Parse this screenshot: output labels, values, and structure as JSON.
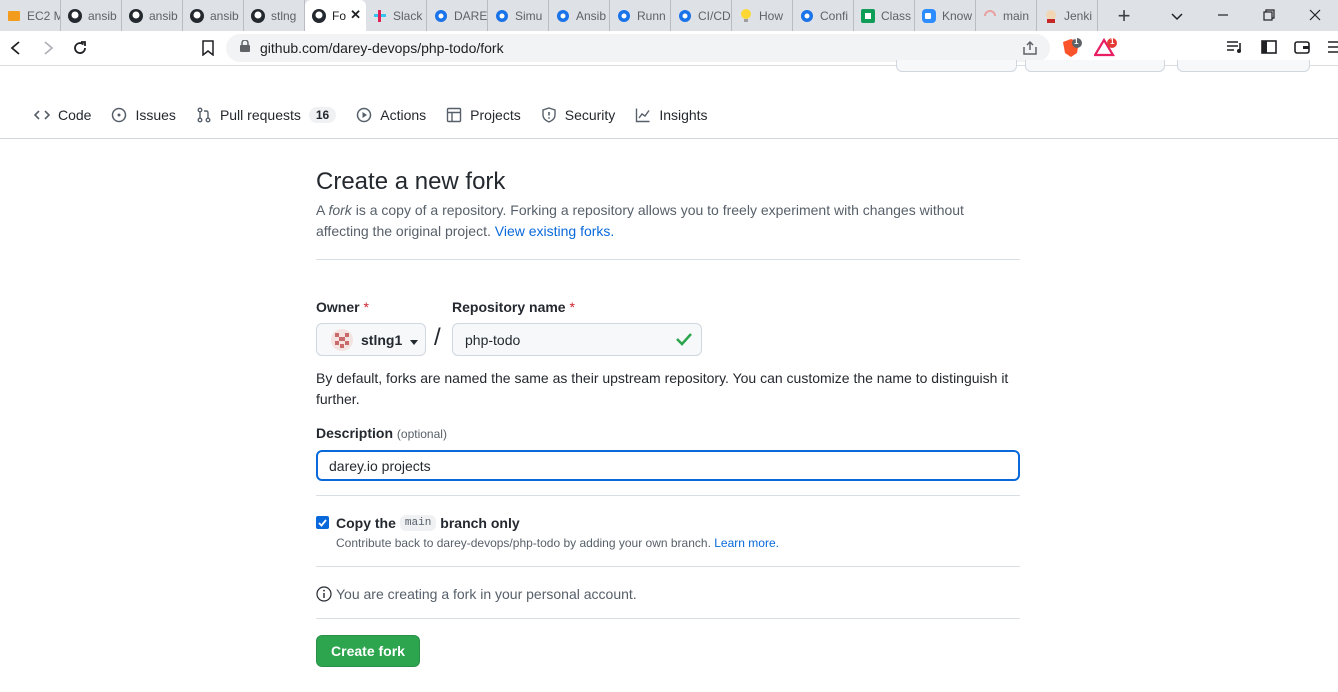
{
  "browser": {
    "tabs": [
      {
        "label": "EC2 M",
        "icon": "aws-icon"
      },
      {
        "label": "ansib",
        "icon": "github-icon"
      },
      {
        "label": "ansib",
        "icon": "github-icon"
      },
      {
        "label": "ansib",
        "icon": "github-icon"
      },
      {
        "label": "stlng",
        "icon": "github-icon"
      },
      {
        "label": "Fo",
        "icon": "github-icon",
        "active": true
      },
      {
        "label": "Slack",
        "icon": "slack-icon"
      },
      {
        "label": "DARE",
        "icon": "darey-icon"
      },
      {
        "label": "Simu",
        "icon": "darey-icon"
      },
      {
        "label": "Ansib",
        "icon": "darey-icon"
      },
      {
        "label": "Runn",
        "icon": "darey-icon"
      },
      {
        "label": "CI/CD",
        "icon": "darey-icon"
      },
      {
        "label": "How",
        "icon": "lightbulb-icon"
      },
      {
        "label": "Confi",
        "icon": "darey-icon"
      },
      {
        "label": "Class",
        "icon": "google-classroom-icon"
      },
      {
        "label": "Know",
        "icon": "zoom-icon"
      },
      {
        "label": "main",
        "icon": "loading-icon"
      },
      {
        "label": "Jenki",
        "icon": "jenkins-icon"
      }
    ],
    "url": "github.com/darey-devops/php-todo/fork",
    "brave_badge": "1",
    "rewards_badge": "1"
  },
  "repo_nav": {
    "items": [
      {
        "label": "Code",
        "icon": "code-icon"
      },
      {
        "label": "Issues",
        "icon": "issue-icon"
      },
      {
        "label": "Pull requests",
        "icon": "pull-request-icon",
        "count": "16"
      },
      {
        "label": "Actions",
        "icon": "play-icon"
      },
      {
        "label": "Projects",
        "icon": "table-icon"
      },
      {
        "label": "Security",
        "icon": "shield-icon"
      },
      {
        "label": "Insights",
        "icon": "graph-icon"
      }
    ]
  },
  "form": {
    "title": "Create a new fork",
    "intro_prefix": "A ",
    "intro_em": "fork",
    "intro_rest": " is a copy of a repository. Forking a repository allows you to freely experiment with changes without affecting the original project. ",
    "intro_link": "View existing forks.",
    "owner_label": "Owner",
    "required_mark": "*",
    "owner_value": "stlng1",
    "slash": "/",
    "repo_label": "Repository name",
    "repo_value": "php-todo",
    "naming_hint": "By default, forks are named the same as their upstream repository. You can customize the name to distinguish it further.",
    "desc_label": "Description",
    "desc_optional": "(optional)",
    "desc_value": "darey.io projects",
    "copy_prefix": "Copy the",
    "copy_branch": "main",
    "copy_suffix": "branch only",
    "copy_checked": true,
    "copy_hint": "Contribute back to darey-devops/php-todo by adding your own branch.",
    "copy_hint_link": "Learn more.",
    "personal_note": "You are creating a fork in your personal account.",
    "submit_label": "Create fork"
  }
}
